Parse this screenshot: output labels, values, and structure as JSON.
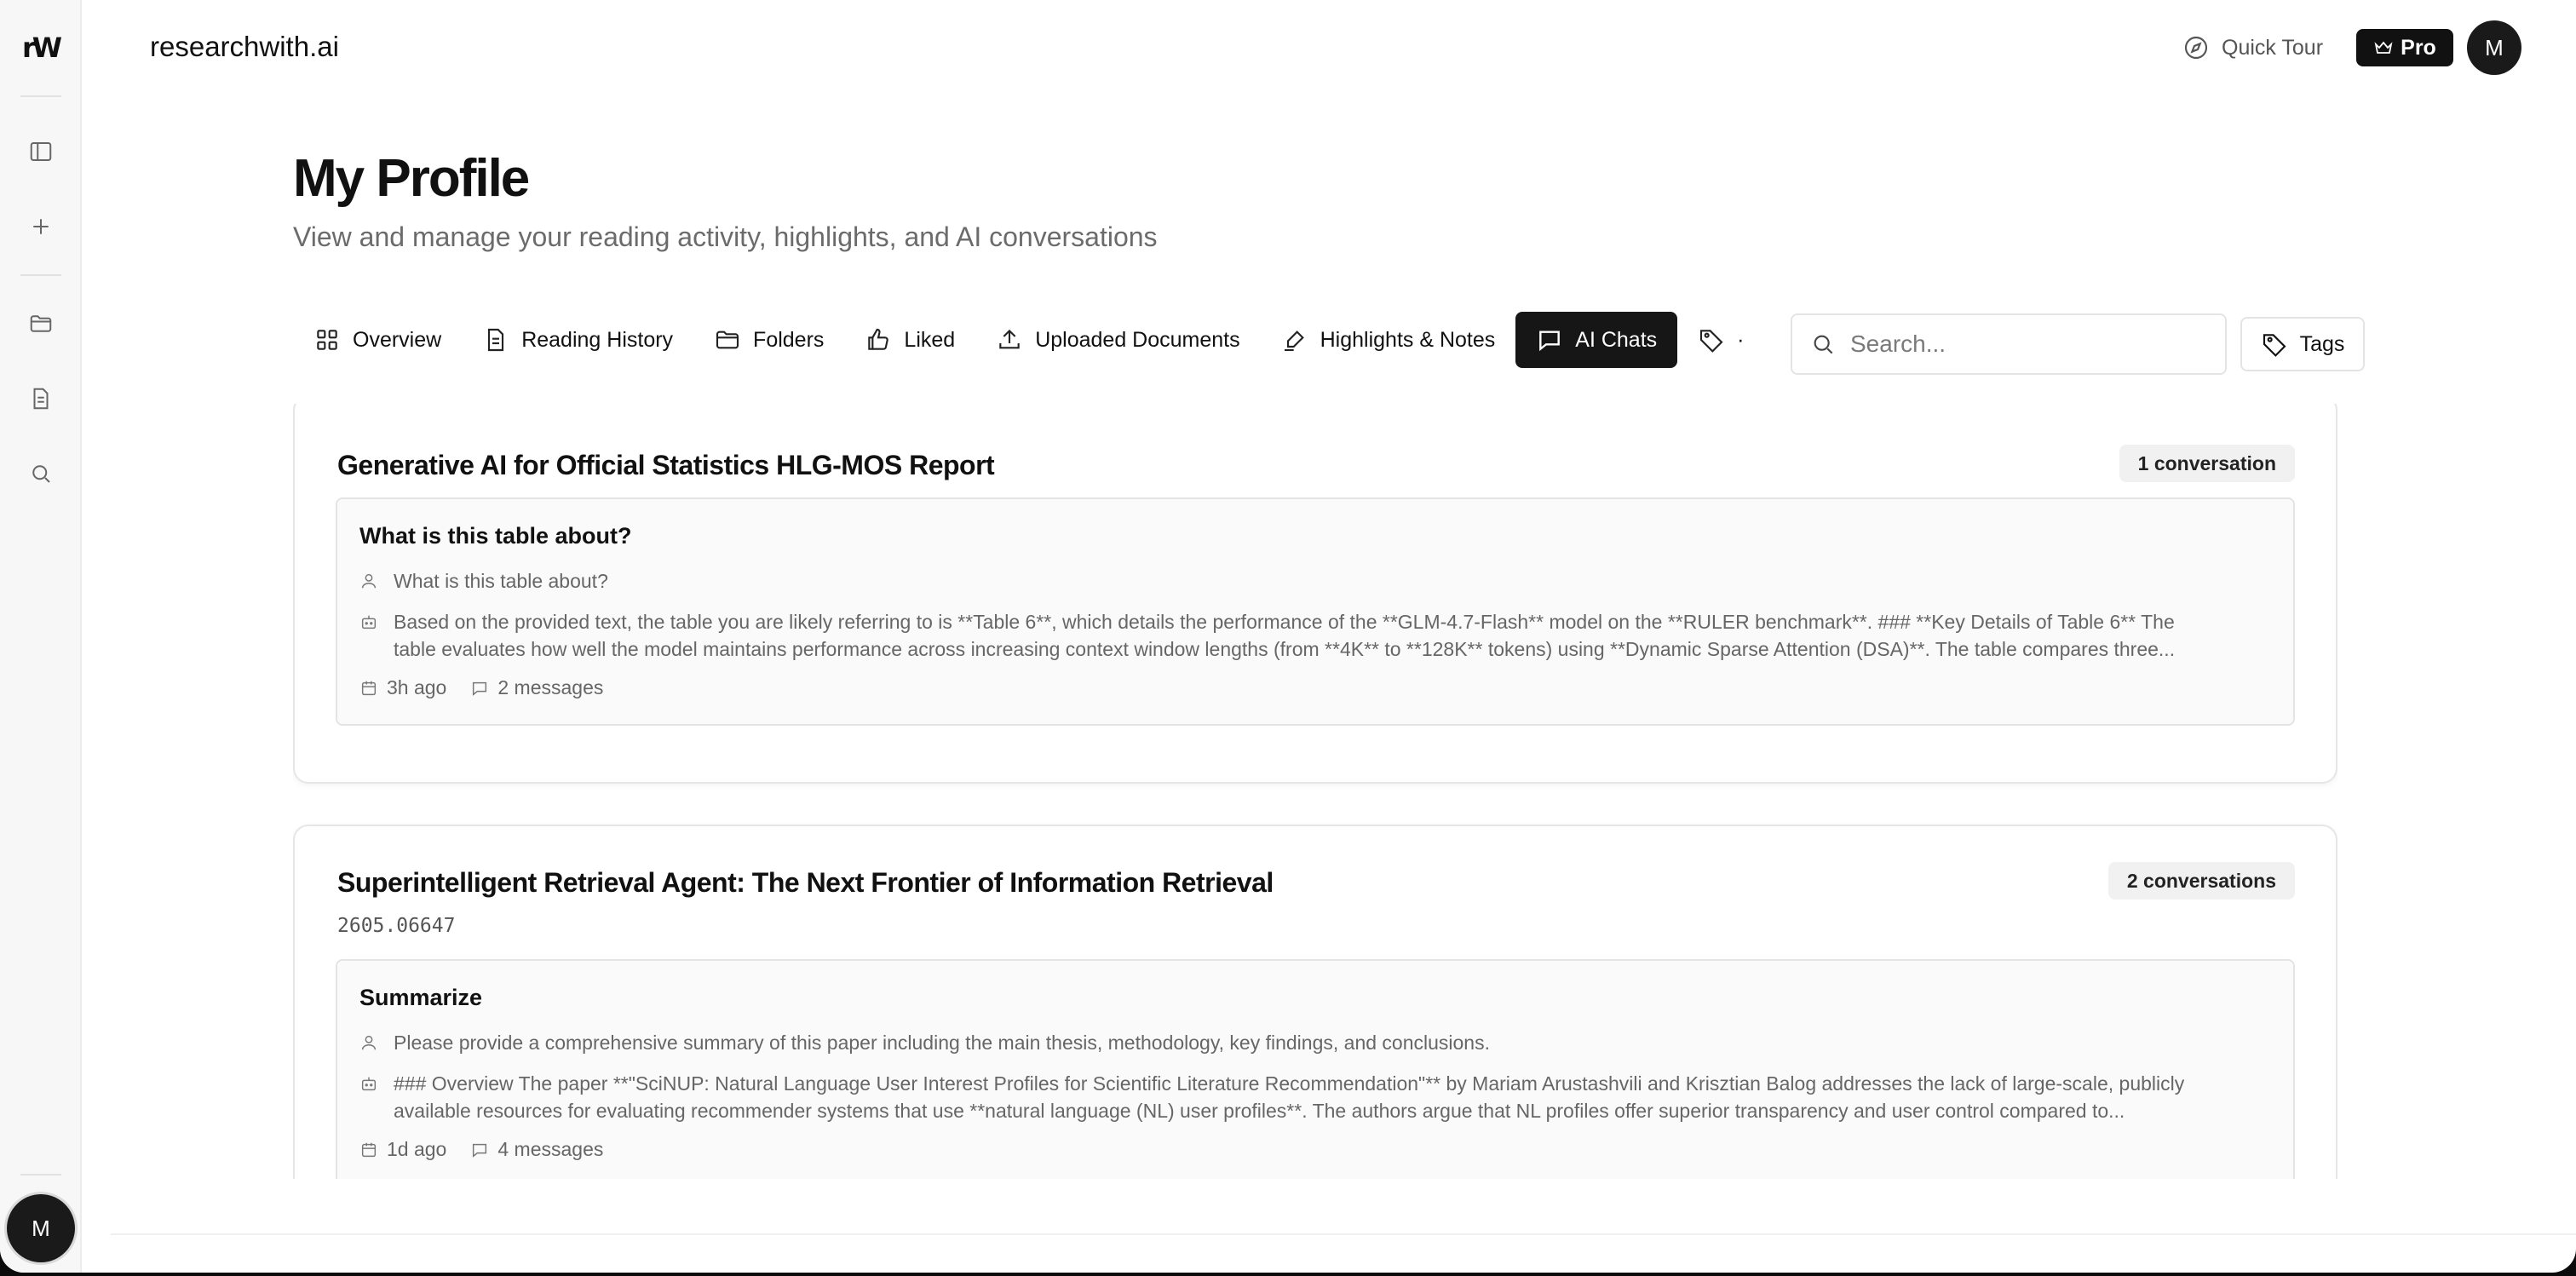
{
  "app": {
    "brand": "researchwith.ai",
    "logo_text": "rW"
  },
  "header": {
    "quick_tour_label": "Quick Tour",
    "pro_label": "Pro",
    "avatar_initial": "M"
  },
  "sidebar": {
    "avatar_initial": "M",
    "icons": [
      "panel-toggle-icon",
      "plus-icon",
      "folder-icon",
      "document-icon",
      "search-icon"
    ]
  },
  "page": {
    "title": "My Profile",
    "subtitle": "View and manage your reading activity, highlights, and AI conversations"
  },
  "tabs": [
    {
      "label": "Overview",
      "icon": "grid-icon",
      "active": false
    },
    {
      "label": "Reading History",
      "icon": "document-icon",
      "active": false
    },
    {
      "label": "Folders",
      "icon": "folder-icon",
      "active": false
    },
    {
      "label": "Liked",
      "icon": "thumbs-up-icon",
      "active": false
    },
    {
      "label": "Uploaded Documents",
      "icon": "upload-icon",
      "active": false
    },
    {
      "label": "Highlights & Notes",
      "icon": "highlighter-icon",
      "active": false
    },
    {
      "label": "AI Chats",
      "icon": "chat-icon",
      "active": true
    },
    {
      "label": "·",
      "icon": "tag-icon",
      "active": false
    }
  ],
  "search": {
    "placeholder": "Search...",
    "value": ""
  },
  "tags_button_label": "Tags",
  "papers": [
    {
      "title": "Generative AI for Official Statistics HLG-MOS Report",
      "arxiv_id": "",
      "conversation_count": "1 conversation",
      "conversations": [
        {
          "title": "What is this table about?",
          "user_message": "What is this table about?",
          "ai_message_line1": "Based on the provided text, the table you are likely referring to is **Table 6**, which details the performance of the **GLM-4.7-Flash** model on the **RULER benchmark**. ### **Key Details of Table 6** The",
          "ai_message_line2": "table evaluates how well the model maintains performance across increasing context window lengths (from **4K** to **128K** tokens) using **Dynamic Sparse Attention (DSA)**. The table compares three...",
          "time": "3h ago",
          "messages": "2 messages"
        }
      ]
    },
    {
      "title": "Superintelligent Retrieval Agent: The Next Frontier of Information Retrieval",
      "arxiv_id": "2605.06647",
      "conversation_count": "2 conversations",
      "conversations": [
        {
          "title": "Summarize",
          "user_message": "Please provide a comprehensive summary of this paper including the main thesis, methodology, key findings, and conclusions.",
          "ai_message_line1": "### Overview The paper **\"SciNUP: Natural Language User Interest Profiles for Scientific Literature Recommendation\"** by Mariam Arustashvili and Krisztian Balog addresses the lack of large-scale, publicly",
          "ai_message_line2": "available resources for evaluating recommender systems that use **natural language (NL) user profiles**. The authors argue that NL profiles offer superior transparency and user control compared to...",
          "time": "1d ago",
          "messages": "4 messages"
        }
      ]
    }
  ]
}
